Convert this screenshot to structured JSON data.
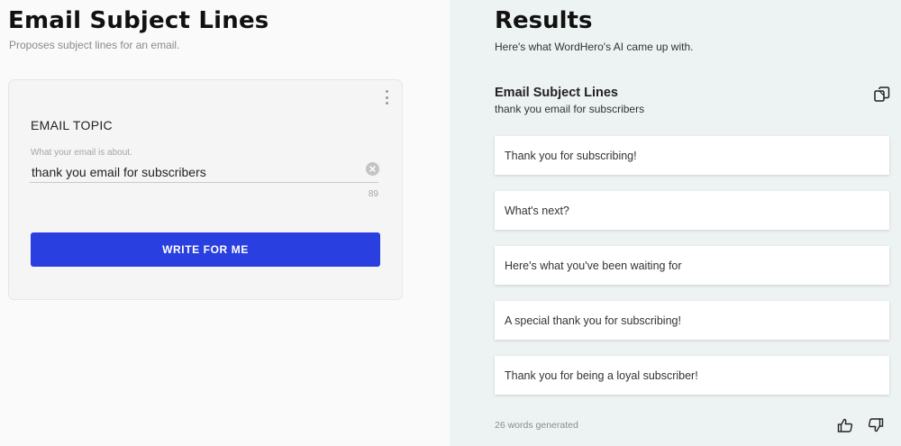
{
  "left": {
    "title": "Email Subject Lines",
    "subtitle": "Proposes subject lines for an email.",
    "form": {
      "field_label": "EMAIL TOPIC",
      "field_hint": "What your email is about.",
      "topic_value": "thank you email for subscribers",
      "char_count": "89",
      "submit_label": "WRITE FOR ME"
    }
  },
  "right": {
    "title": "Results",
    "subtitle": "Here's what WordHero's AI came up with.",
    "result_set": {
      "title": "Email Subject Lines",
      "topic": "thank you email for subscribers",
      "items": [
        "Thank you for subscribing!",
        "What's next?",
        "Here's what you've been waiting for",
        "A special thank you for subscribing!",
        "Thank you for being a loyal subscriber!"
      ],
      "words_generated": "26 words generated"
    }
  },
  "icons": {
    "menu": "kebab-menu-icon",
    "clear": "clear-circle-x-icon",
    "copy": "copy-icon",
    "like": "thumbs-up-icon",
    "dislike": "thumbs-down-icon"
  },
  "colors": {
    "primary_button": "#2a3fe0",
    "results_background": "#edf2f2",
    "form_background": "#fafafa"
  }
}
